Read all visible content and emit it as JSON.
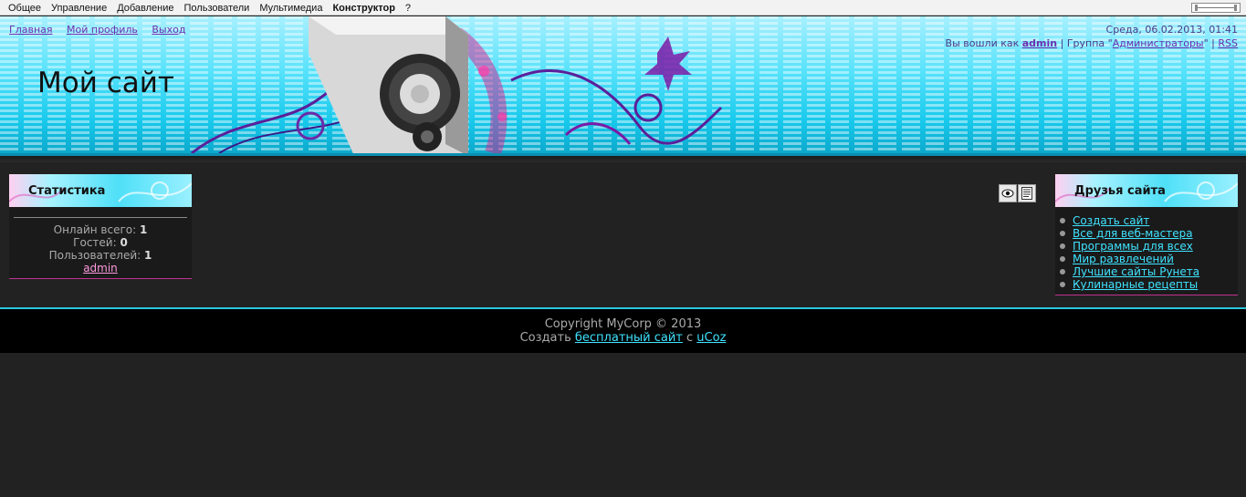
{
  "adminbar": {
    "items": [
      "Общее",
      "Управление",
      "Добавление",
      "Пользователи",
      "Мультимедиа",
      "Конструктор",
      "?"
    ]
  },
  "header": {
    "nav": [
      "Главная",
      "Мой профиль",
      "Выход"
    ],
    "site_title": "Мой сайт",
    "date": "Среда, 06.02.2013, 01:41",
    "logged_in_prefix": "Вы вошли как ",
    "username": "admin",
    "group_prefix": " | Группа \"",
    "group": "Администраторы",
    "group_suffix": "\" | ",
    "rss": "RSS"
  },
  "stats_block": {
    "title": "Статистика",
    "online_label": "Онлайн всего: ",
    "online_value": "1",
    "guests_label": "Гостей: ",
    "guests_value": "0",
    "users_label": "Пользователей: ",
    "users_value": "1",
    "user_link": "admin"
  },
  "friends_block": {
    "title": "Друзья сайта",
    "links": [
      "Создать сайт",
      "Все для веб-мастера",
      "Программы для всех",
      "Мир развлечений",
      "Лучшие сайты Рунета",
      "Кулинарные рецепты"
    ]
  },
  "tools": [
    "eye-icon",
    "page-list-icon"
  ],
  "footer": {
    "copyright": "Copyright MyCorp © 2013",
    "create_prefix": "Создать ",
    "create_link": "бесплатный сайт",
    "create_mid": " с ",
    "ucoz_link": "uCoz"
  },
  "colors": {
    "background": "#222222",
    "link_cyan": "#3fe3ff",
    "link_purple": "#6b2fae",
    "footer_border": "#2bc7dd"
  }
}
